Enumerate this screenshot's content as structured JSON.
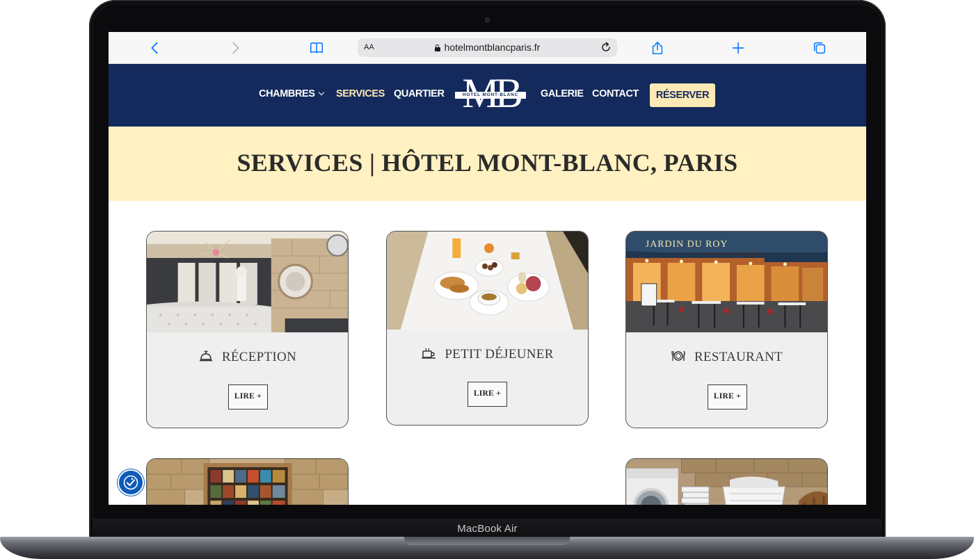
{
  "device": {
    "label": "MacBook Air"
  },
  "browser": {
    "url": "hotelmontblancparis.fr",
    "text_size_label": "AA",
    "icons": [
      "back-icon",
      "forward-icon",
      "bookmarks-icon",
      "reload-icon",
      "share-icon",
      "new-tab-icon",
      "tabs-icon"
    ],
    "accent_color": "#0a7aff"
  },
  "nav": {
    "items": [
      {
        "label": "CHAMBRES",
        "has_dropdown": true
      },
      {
        "label": "SERVICES",
        "active": true
      },
      {
        "label": "QUARTIER"
      },
      {
        "label": "GALERIE"
      },
      {
        "label": "CONTACT"
      }
    ],
    "logo": {
      "monogram": "MB",
      "text": "HOTEL MONT-BLANC"
    },
    "reserve_label": "RÉSERVER",
    "colors": {
      "background": "#142a5c",
      "active": "#fde9b4",
      "button": "#fde9b4"
    }
  },
  "hero": {
    "title": "SERVICES | HÔTEL MONT-BLANC, PARIS",
    "background": "#fff1c1"
  },
  "cards": [
    {
      "title": "RÉCEPTION",
      "icon": "reception-bell-icon",
      "button": "LIRE +"
    },
    {
      "title": "PETIT DÉJEUNER",
      "icon": "breakfast-icon",
      "button": "LIRE +"
    },
    {
      "title": "RESTAURANT",
      "icon": "restaurant-icon",
      "button": "LIRE +"
    }
  ],
  "partial_cards": [
    {
      "image": "library-bookshelf"
    },
    {
      "image": "laundry-room"
    }
  ],
  "accessibility": {
    "icon": "accessibility-icon"
  }
}
